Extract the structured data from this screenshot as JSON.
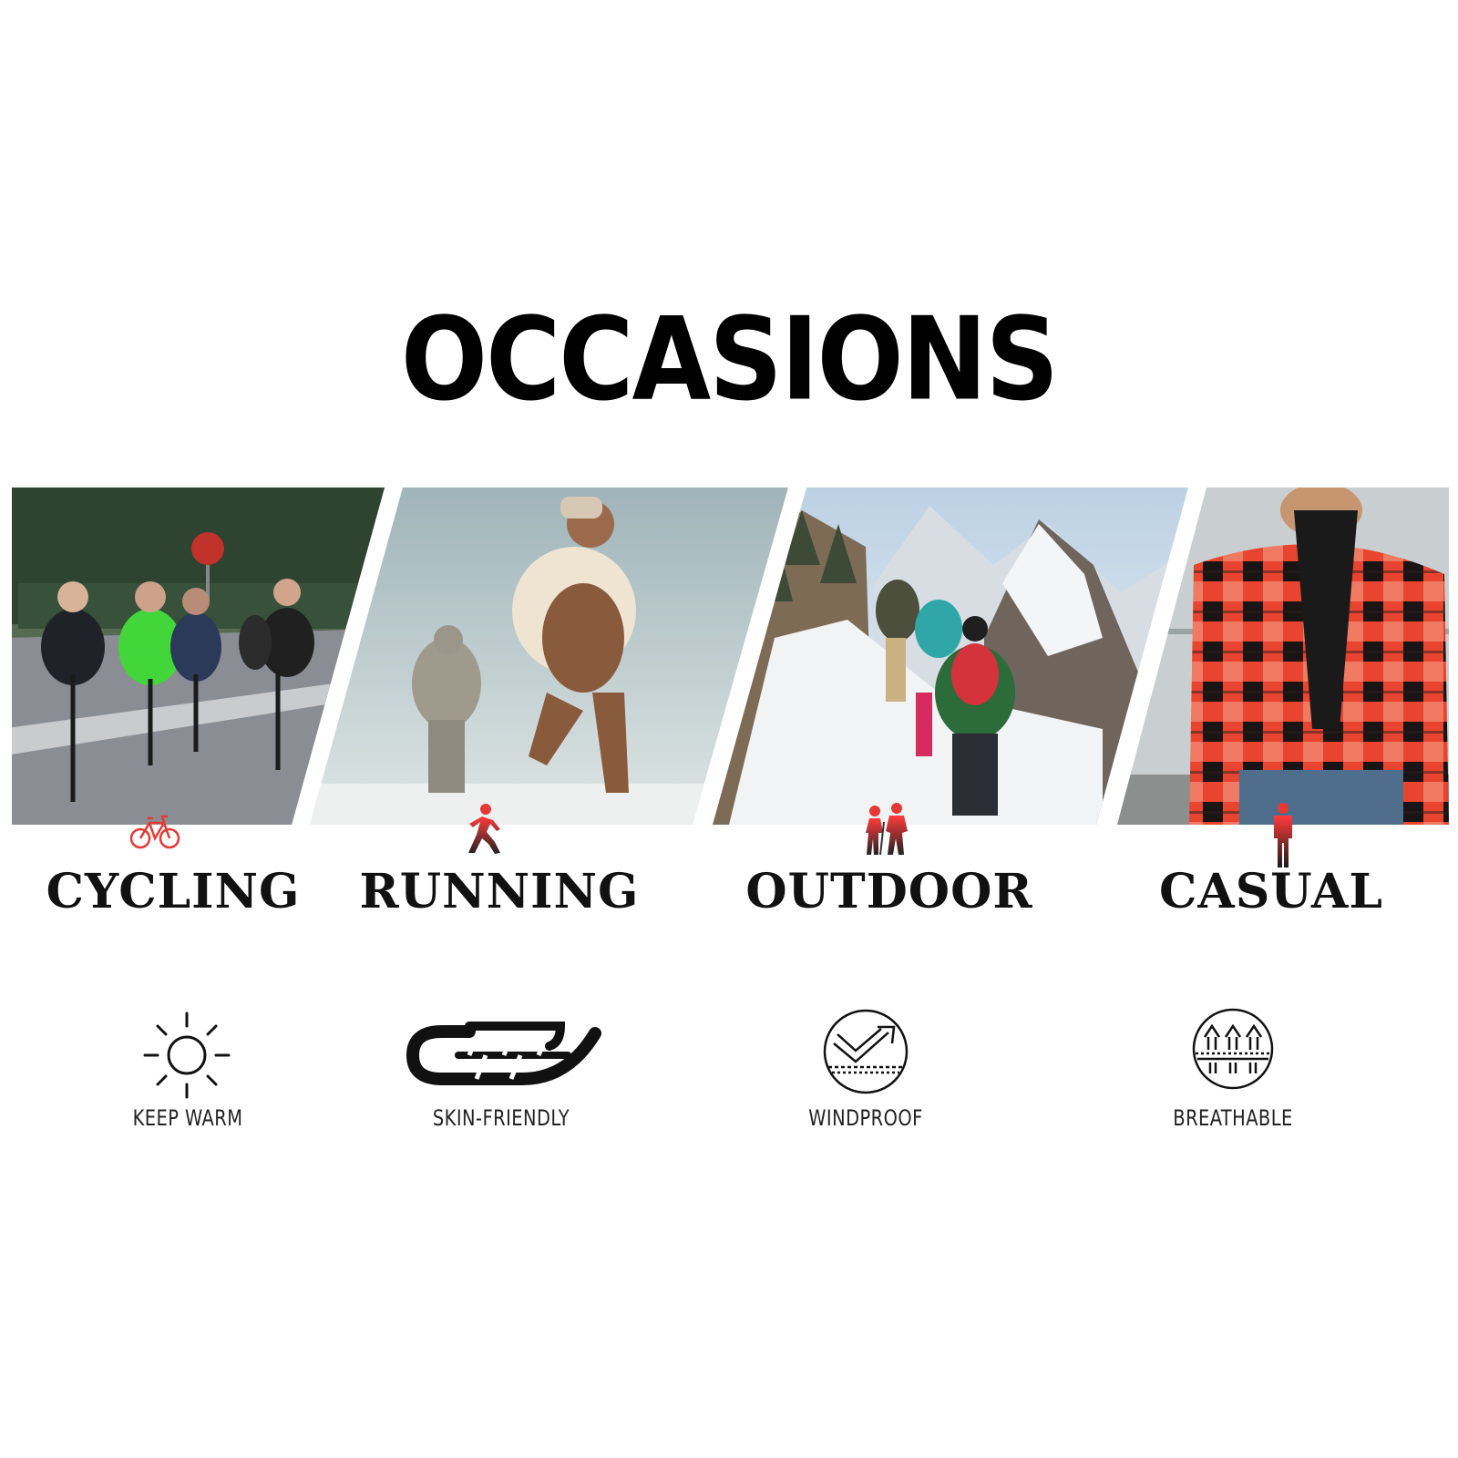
{
  "title": "OCCASIONS",
  "occasions": [
    {
      "label": "CYCLING",
      "icon": "bicycle-icon"
    },
    {
      "label": "RUNNING",
      "icon": "runner-icon"
    },
    {
      "label": "OUTDOOR",
      "icon": "hikers-icon"
    },
    {
      "label": "CASUAL",
      "icon": "standing-person-icon"
    }
  ],
  "features": [
    {
      "label": "KEEP WARM",
      "icon": "sun-icon"
    },
    {
      "label": "SKIN-FRIENDLY",
      "icon": "feather-icon"
    },
    {
      "label": "WINDPROOF",
      "icon": "wind-arrow-icon"
    },
    {
      "label": "BREATHABLE",
      "icon": "breathable-arrows-icon"
    }
  ],
  "photos": {
    "cycling": "group of cyclists on a road",
    "running": "two people jogging in snow",
    "outdoor": "hikers on a snowy mountain trail",
    "casual": "man in red plaid jacket and scarf"
  },
  "colors": {
    "accent_red": "#e53935",
    "text": "#111111"
  }
}
